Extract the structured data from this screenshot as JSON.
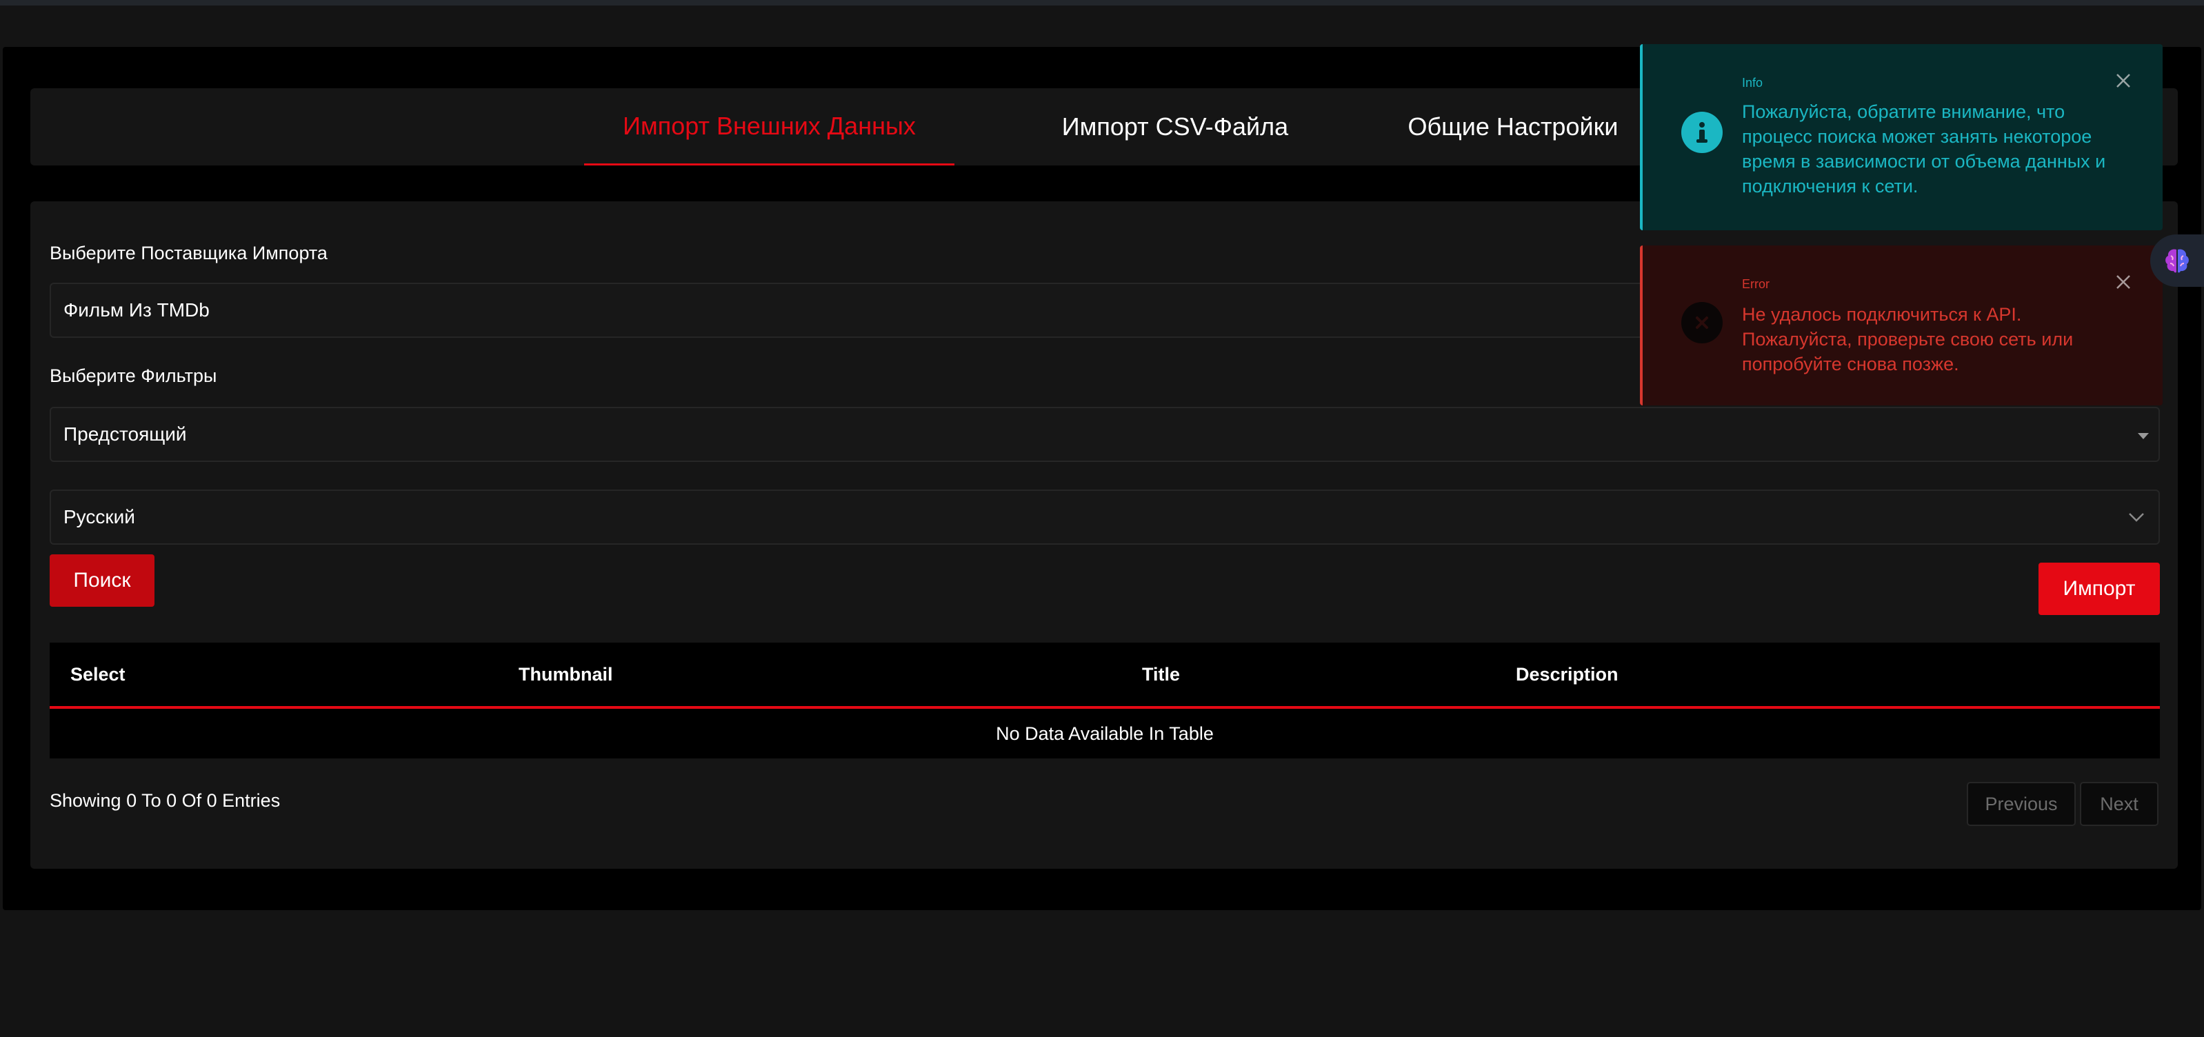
{
  "tabs": [
    {
      "label": "Импорт Внешних Данных",
      "active": true
    },
    {
      "label": "Импорт CSV-Файла",
      "active": false
    },
    {
      "label": "Общие Настройки",
      "active": false
    }
  ],
  "form": {
    "provider_label": "Выберите Поставщика Импорта",
    "provider_value": "Фильм Из TMDb",
    "filters_label": "Выберите Фильтры",
    "filter_value": "Предстоящий",
    "language_value": "Русский",
    "search_button": "Поиск",
    "import_button": "Импорт"
  },
  "table": {
    "columns": [
      "Select",
      "Thumbnail",
      "Title",
      "Description"
    ],
    "empty_text": "No Data Available In Table",
    "info": "Showing 0 To 0 Of 0 Entries",
    "prev_label": "Previous",
    "next_label": "Next"
  },
  "toasts": {
    "info": {
      "title": "Info",
      "message": "Пожалуйста, обратите внимание, что процесс поиска может занять некоторое время в зависимости от объема данных и подключения к сети.",
      "color": "#1bb7c3"
    },
    "error": {
      "title": "Error",
      "message": "Не удалось подключиться к API. Пожалуйста, проверьте свою сеть или попробуйте снова позже.",
      "color": "#d7372e"
    }
  },
  "theme": {
    "accent": "#e50914",
    "background": "#141414",
    "panel": "#151515"
  },
  "icons": {
    "side_widget": "brain-icon",
    "info": "info-circle-icon",
    "error": "x-circle-icon"
  }
}
